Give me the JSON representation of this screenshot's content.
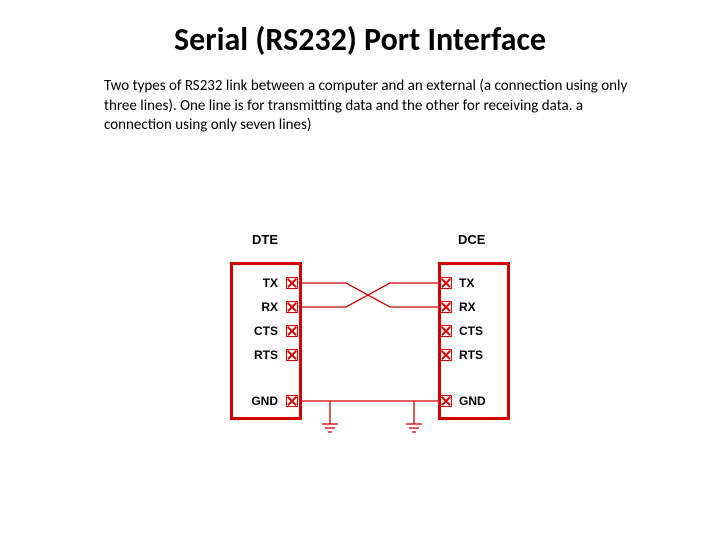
{
  "title": "Serial (RS232) Port Interface",
  "description": "Two types of RS232 link between a computer and an external  (a connection using only three lines). One line is for transmitting data and the other for receiving data. a connection using only seven lines)",
  "diagram": {
    "left_box_label": "DTE",
    "right_box_label": "DCE",
    "left_pins": [
      "TX",
      "RX",
      "CTS",
      "RTS",
      "GND"
    ],
    "right_pins": [
      "TX",
      "RX",
      "CTS",
      "RTS",
      "GND"
    ],
    "connections": [
      {
        "from": "TX",
        "to": "RX",
        "type": "cross"
      },
      {
        "from": "RX",
        "to": "TX",
        "type": "cross"
      },
      {
        "from": "GND",
        "to": "GND",
        "type": "straight"
      }
    ],
    "colors": {
      "box_border": "#d40000",
      "wire": "#d40000",
      "text": "#000000"
    }
  }
}
